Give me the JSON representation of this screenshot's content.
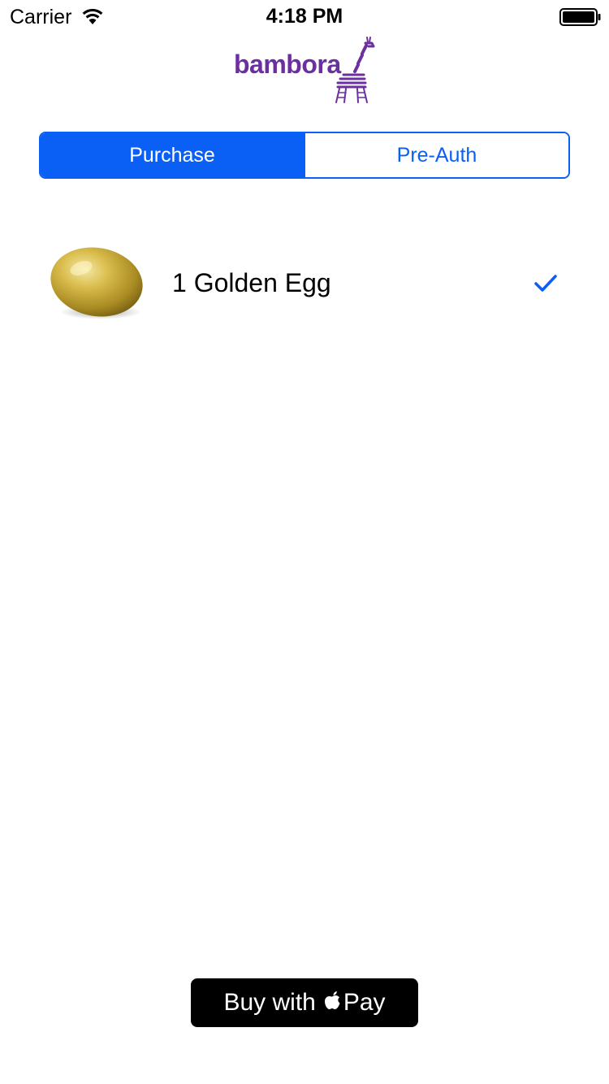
{
  "status_bar": {
    "carrier": "Carrier",
    "time": "4:18 PM",
    "battery_level": 1.0,
    "wifi_icon": "wifi-icon",
    "battery_icon": "battery-icon"
  },
  "logo": {
    "text": "bambora",
    "color": "#6c2fa0",
    "icon": "giraffe-icon"
  },
  "segmented_control": {
    "segments": [
      {
        "label": "Purchase",
        "selected": true
      },
      {
        "label": "Pre-Auth",
        "selected": false
      }
    ]
  },
  "product": {
    "name": "1 Golden Egg",
    "image_icon": "golden-egg-image",
    "checked": true
  },
  "apple_pay": {
    "prefix": "Buy with",
    "suffix": "Pay",
    "icon": "apple-logo-icon"
  },
  "colors": {
    "accent": "#0a5ff5",
    "brand": "#6c2fa0",
    "button_bg": "#000000"
  }
}
